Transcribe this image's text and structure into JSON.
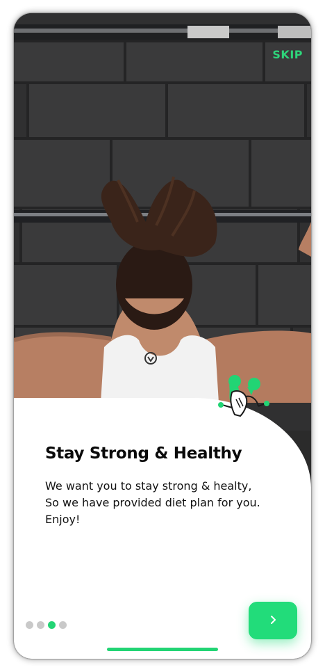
{
  "header": {
    "skip_label": "SKIP"
  },
  "content": {
    "title": "Stay Strong & Healthy",
    "description_lines": [
      "We want you to stay strong & healty,",
      "So we have provided diet plan for you.",
      "Enjoy!"
    ]
  },
  "pagination": {
    "total": 4,
    "current": 3
  },
  "next_button": {
    "icon": "chevron-right-icon"
  },
  "colors": {
    "accent": "#22DC7A",
    "dot_inactive": "#C9C9C9",
    "card": "#FFFFFF",
    "title": "#0A0A0A"
  }
}
